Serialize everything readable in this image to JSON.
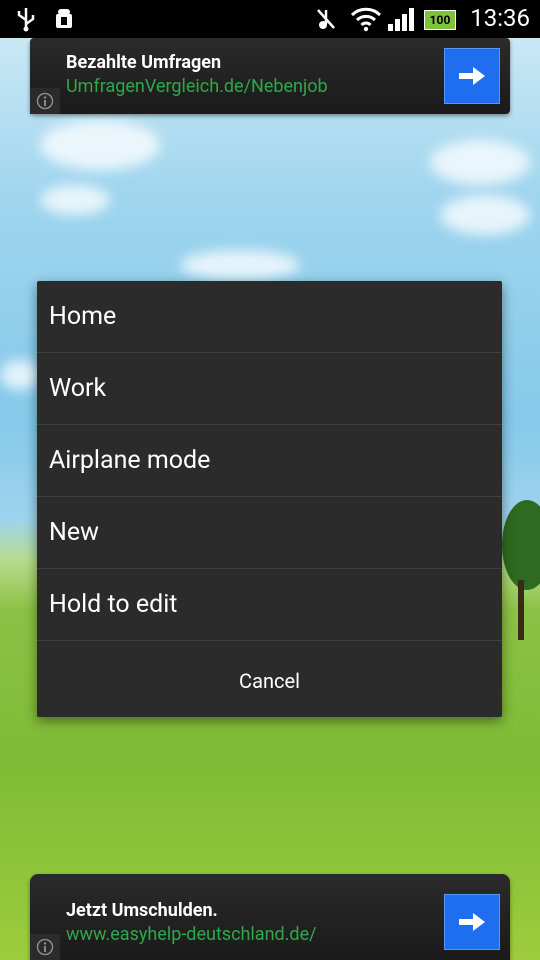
{
  "status_bar": {
    "time": "13:36",
    "battery_level": "100",
    "icons": [
      "usb-icon",
      "android-debug-icon",
      "mute-icon",
      "wifi-icon",
      "signal-icon",
      "battery-icon"
    ]
  },
  "top_ad": {
    "title": "Bezahlte Umfragen",
    "url": "UmfragenVergleich.de/Nebenjob"
  },
  "dialog": {
    "items": [
      {
        "label": "Home"
      },
      {
        "label": "Work"
      },
      {
        "label": "Airplane mode"
      },
      {
        "label": "New"
      },
      {
        "label": "Hold to edit"
      }
    ],
    "cancel_label": "Cancel"
  },
  "bottom_ad": {
    "title": "Jetzt Umschulden.",
    "url": "www.easyhelp-deutschland.de/"
  },
  "colors": {
    "dialog_bg": "#2b2b2b",
    "ad_url": "#2ea84a",
    "ad_button": "#1f6ef0"
  }
}
